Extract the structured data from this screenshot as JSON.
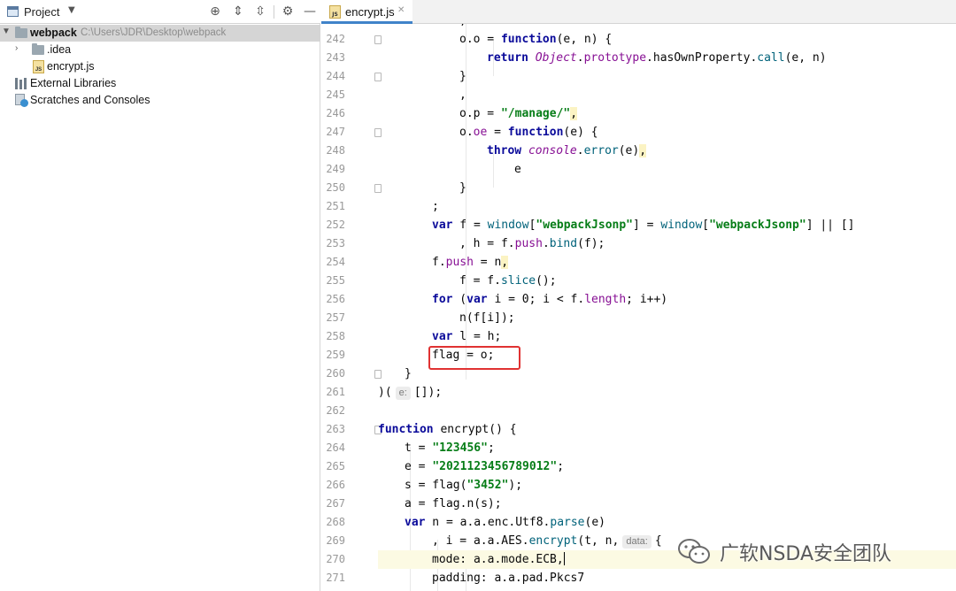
{
  "project_panel": {
    "title": "Project",
    "tree": [
      {
        "label": "webpack",
        "path": "C:\\Users\\JDR\\Desktop\\webpack"
      },
      {
        "label": ".idea"
      },
      {
        "label": "encrypt.js"
      },
      {
        "label": "External Libraries"
      },
      {
        "label": "Scratches and Consoles"
      }
    ]
  },
  "editor": {
    "tab": {
      "label": "encrypt.js",
      "icon": "js-file-icon"
    },
    "partial_top_line": ",",
    "lines": [
      {
        "n": "242",
        "code": "o.o = function(e, n) {"
      },
      {
        "n": "243",
        "code": "return Object.prototype.hasOwnProperty.call(e, n)"
      },
      {
        "n": "244",
        "code": "}"
      },
      {
        "n": "245",
        "code": ","
      },
      {
        "n": "246",
        "code": "o.p = \"/manage/\","
      },
      {
        "n": "247",
        "code": "o.oe = function(e) {"
      },
      {
        "n": "248",
        "code": "throw console.error(e),"
      },
      {
        "n": "249",
        "code": "e"
      },
      {
        "n": "250",
        "code": "}"
      },
      {
        "n": "251",
        "code": ";"
      },
      {
        "n": "252",
        "code": "var f = window[\"webpackJsonp\"] = window[\"webpackJsonp\"] || []"
      },
      {
        "n": "253",
        "code": ", h = f.push.bind(f);"
      },
      {
        "n": "254",
        "code": "f.push = n,"
      },
      {
        "n": "255",
        "code": "f = f.slice();"
      },
      {
        "n": "256",
        "code": "for (var i = 0; i < f.length; i++)"
      },
      {
        "n": "257",
        "code": "n(f[i]);"
      },
      {
        "n": "258",
        "code": "var l = h;"
      },
      {
        "n": "259",
        "code": "flag = o;"
      },
      {
        "n": "260",
        "code": "}"
      },
      {
        "n": "261",
        "code": ")( e: []);"
      },
      {
        "n": "262",
        "code": ""
      },
      {
        "n": "263",
        "code": "function encrypt() {"
      },
      {
        "n": "264",
        "code": "t = \"123456\";"
      },
      {
        "n": "265",
        "code": "e = \"2021123456789012\";"
      },
      {
        "n": "266",
        "code": "s = flag(\"3452\");"
      },
      {
        "n": "267",
        "code": "a = flag.n(s);"
      },
      {
        "n": "268",
        "code": "var n = a.a.enc.Utf8.parse(e)"
      },
      {
        "n": "269",
        "code": ", i = a.a.AES.encrypt(t, n,  data: {"
      },
      {
        "n": "270",
        "code": "mode: a.a.mode.ECB,"
      },
      {
        "n": "271",
        "code": "padding: a.a.pad.Pkcs7"
      }
    ],
    "hints": {
      "param_e": "e:",
      "param_data": "data:"
    },
    "current_line": "270",
    "highlighted_line": "259"
  },
  "watermark": {
    "text": "广软NSDA安全团队"
  },
  "colors": {
    "keyword": "#0a0a9a",
    "string": "#067d17",
    "highlight_box": "#e03232",
    "tab_underline": "#4083c9"
  }
}
